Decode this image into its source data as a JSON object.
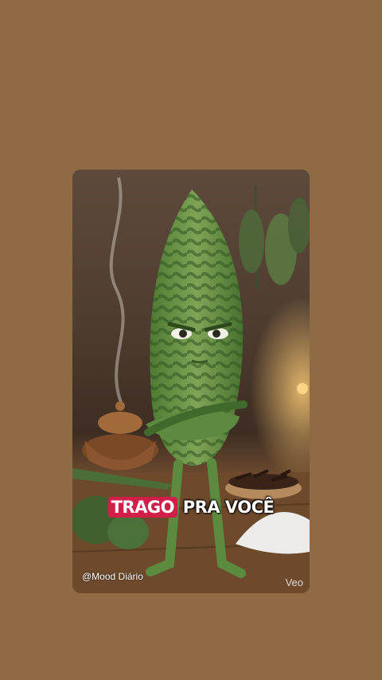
{
  "video": {
    "caption_highlight": "TRAGO",
    "caption_rest": "PRA VOCÊ",
    "watermark_left": "@Mood Diário",
    "watermark_right": "Veo"
  },
  "colors": {
    "page_background": "#8f6a45",
    "caption_highlight": "#d11f4a"
  }
}
